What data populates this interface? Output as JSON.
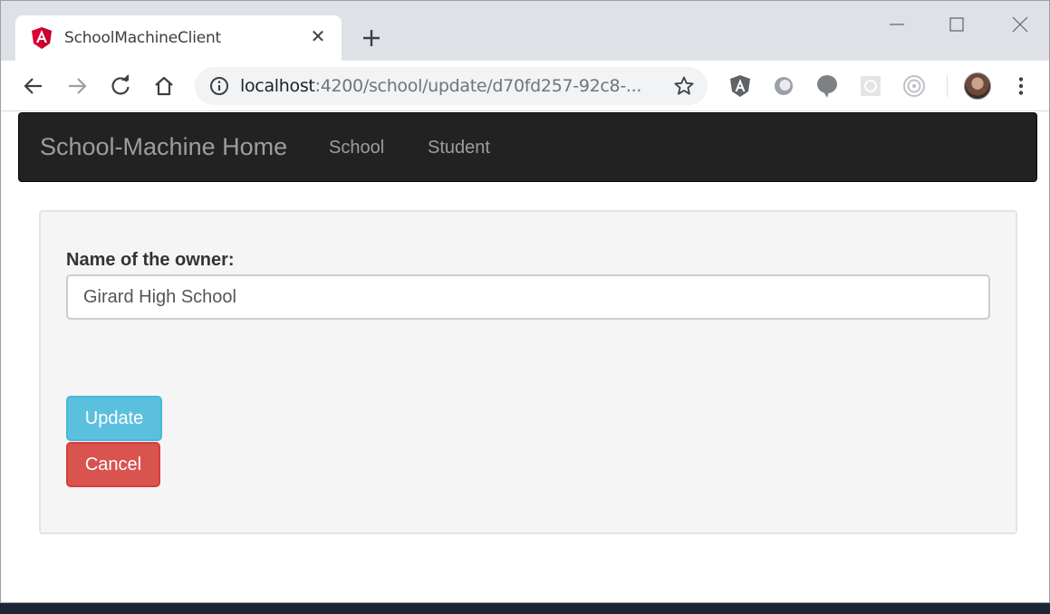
{
  "browser": {
    "tab": {
      "title": "SchoolMachineClient",
      "favicon": "angular-icon",
      "close_glyph": "✕"
    },
    "new_tab_icon": "plus-icon",
    "window_controls": [
      "minimize-icon",
      "maximize-icon",
      "close-icon"
    ],
    "address_bar": {
      "host": "localhost",
      "path": ":4200/school/update/d70fd257-92c8-..."
    },
    "extensions": [
      "angular-icon",
      "extension-icon",
      "chat-bubble-icon",
      "extension-icon",
      "target-icon"
    ]
  },
  "navbar": {
    "brand": "School-Machine Home",
    "links": [
      {
        "label": "School"
      },
      {
        "label": "Student"
      }
    ]
  },
  "form": {
    "owner_label": "Name of the owner:",
    "owner_value": "Girard High School",
    "update_label": "Update",
    "cancel_label": "Cancel"
  },
  "colors": {
    "navbar_bg": "#222222",
    "update_button": "#5bc0de",
    "cancel_button": "#d9534f",
    "well_bg": "#f5f5f5"
  }
}
